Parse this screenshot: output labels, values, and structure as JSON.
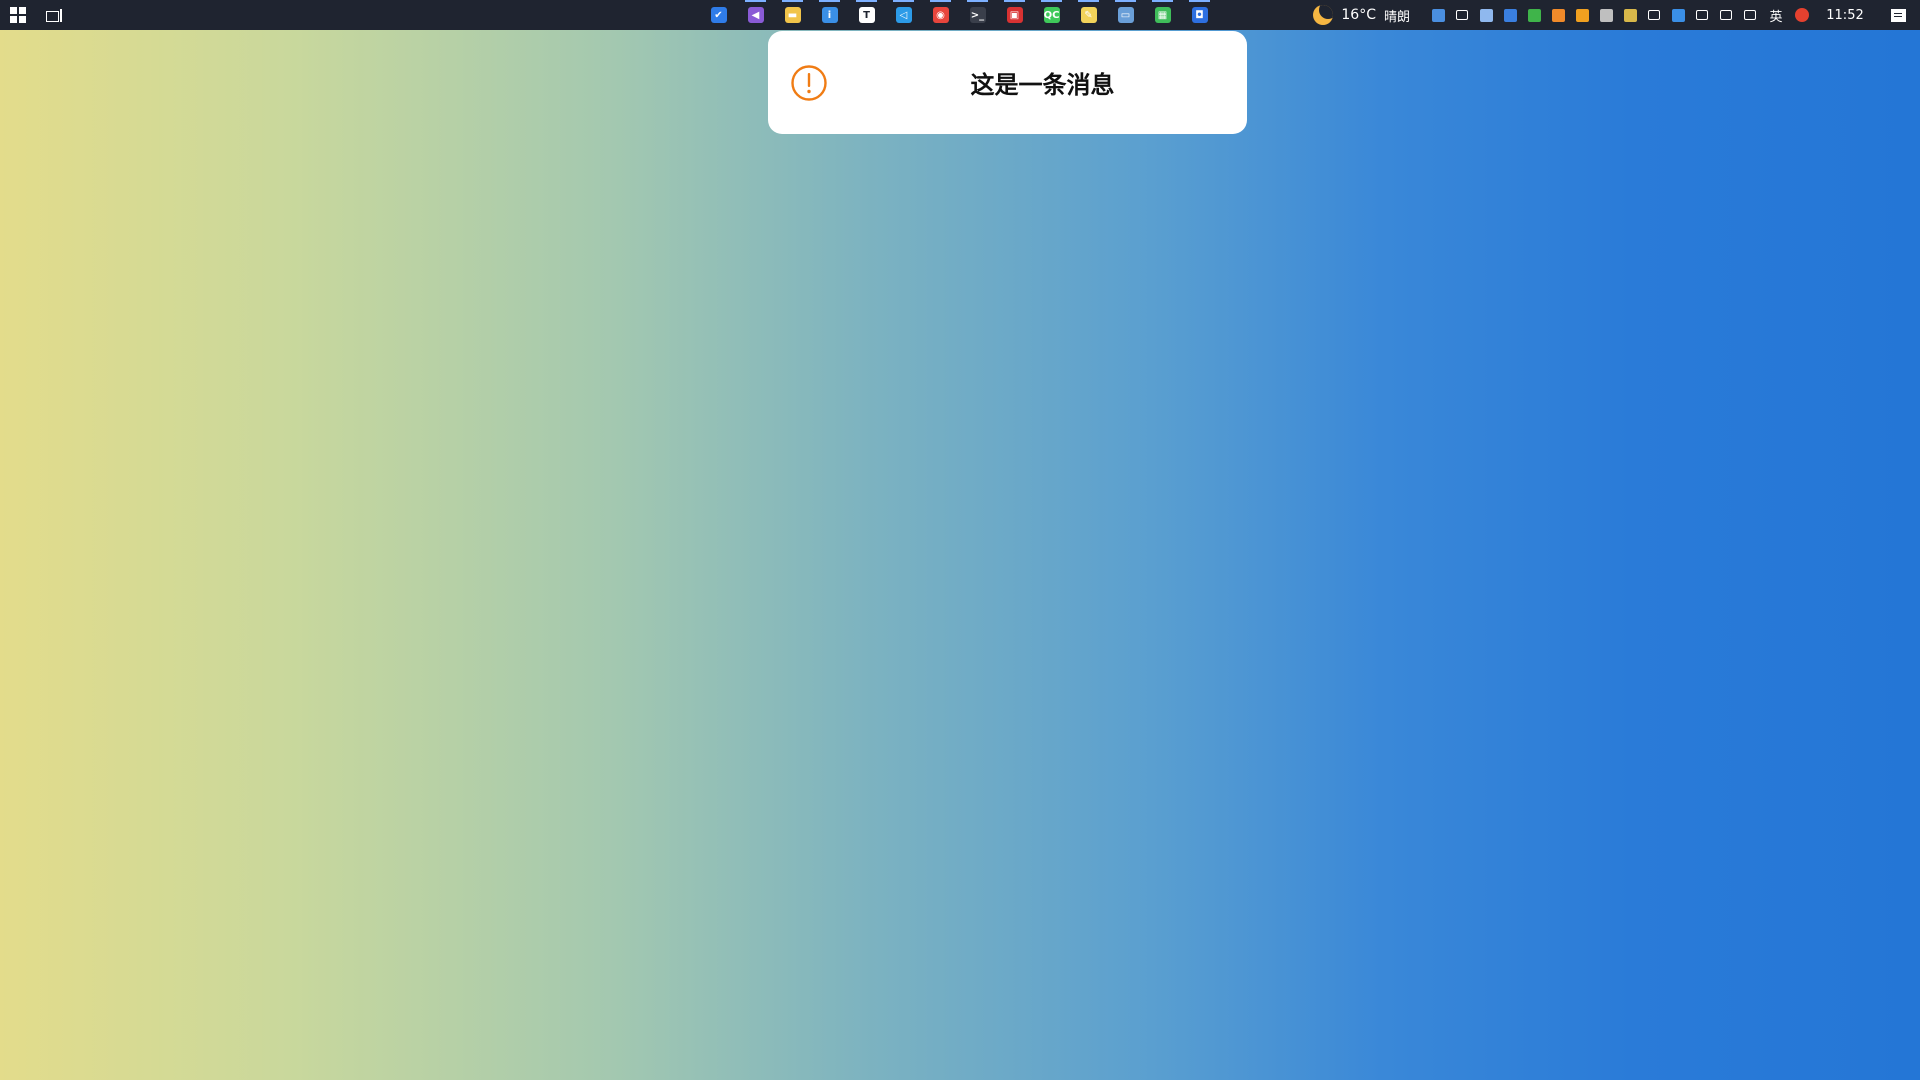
{
  "taskbar": {
    "start_icon": "windows-logo-icon",
    "task_view_icon": "task-view-icon",
    "apps": [
      {
        "icon": "todo-check-icon",
        "color": "#2f7ce8",
        "glyph": "✔",
        "running": false
      },
      {
        "icon": "visual-studio-icon",
        "color": "#8a5bd6",
        "glyph": "◀",
        "running": true
      },
      {
        "icon": "file-explorer-icon",
        "color": "#f1c44a",
        "glyph": "▬",
        "running": true
      },
      {
        "icon": "info-app-icon",
        "color": "#3a8fe6",
        "glyph": "i",
        "running": true
      },
      {
        "icon": "typora-icon",
        "color": "#ffffff",
        "glyph": "T",
        "running": true
      },
      {
        "icon": "vscode-icon",
        "color": "#2c9be8",
        "glyph": "◁",
        "running": true
      },
      {
        "icon": "chrome-icon",
        "color": "#e8453c",
        "glyph": "◉",
        "running": true
      },
      {
        "icon": "terminal-icon",
        "color": "#3a3f4b",
        "glyph": ">_",
        "running": true
      },
      {
        "icon": "red-app-icon",
        "color": "#d83232",
        "glyph": "▣",
        "running": true
      },
      {
        "icon": "qt-creator-icon",
        "color": "#3fc95a",
        "glyph": "QC",
        "running": true
      },
      {
        "icon": "notepad-icon",
        "color": "#f2d35a",
        "glyph": "✎",
        "running": true
      },
      {
        "icon": "remote-desktop-icon",
        "color": "#6a9fd8",
        "glyph": "▭",
        "running": true
      },
      {
        "icon": "spreadsheet-icon",
        "color": "#3fbd5a",
        "glyph": "▦",
        "running": true
      },
      {
        "icon": "blue-app-icon",
        "color": "#2d6fe0",
        "glyph": "◘",
        "running": true
      }
    ],
    "weather": {
      "icon": "moon-icon",
      "temperature": "16°C",
      "condition": "晴朗"
    },
    "tray": [
      {
        "icon": "tray-app-icon",
        "color": "#4a8fe0"
      },
      {
        "icon": "tray-arrow-icon",
        "color": "#ffffff"
      },
      {
        "icon": "tray-drive-icon",
        "color": "#8fb8ee"
      },
      {
        "icon": "tray-shield-icon",
        "color": "#3a7fe0"
      },
      {
        "icon": "tray-green-icon",
        "color": "#3fb44a"
      },
      {
        "icon": "tray-orange-icon",
        "color": "#f08a2a"
      },
      {
        "icon": "tray-search-icon",
        "color": "#f0a020"
      },
      {
        "icon": "tray-settings-icon",
        "color": "#bfbfbf"
      },
      {
        "icon": "tray-yellow-icon",
        "color": "#d8b84a"
      },
      {
        "icon": "network-icon",
        "color": "#ffffff"
      },
      {
        "icon": "onedrive-icon",
        "color": "#3a8fe6"
      },
      {
        "icon": "volume-icon",
        "color": "#ffffff"
      },
      {
        "icon": "tray-grid-icon",
        "color": "#ffffff"
      },
      {
        "icon": "keyboard-icon",
        "color": "#ffffff"
      }
    ],
    "ime_label": "英",
    "sogou_icon": "sogou-icon",
    "clock": "11:52",
    "notification_icon": "notification-center-icon"
  },
  "toast": {
    "icon": "warning-circle-icon",
    "icon_color": "#f07c14",
    "message": "这是一条消息"
  }
}
